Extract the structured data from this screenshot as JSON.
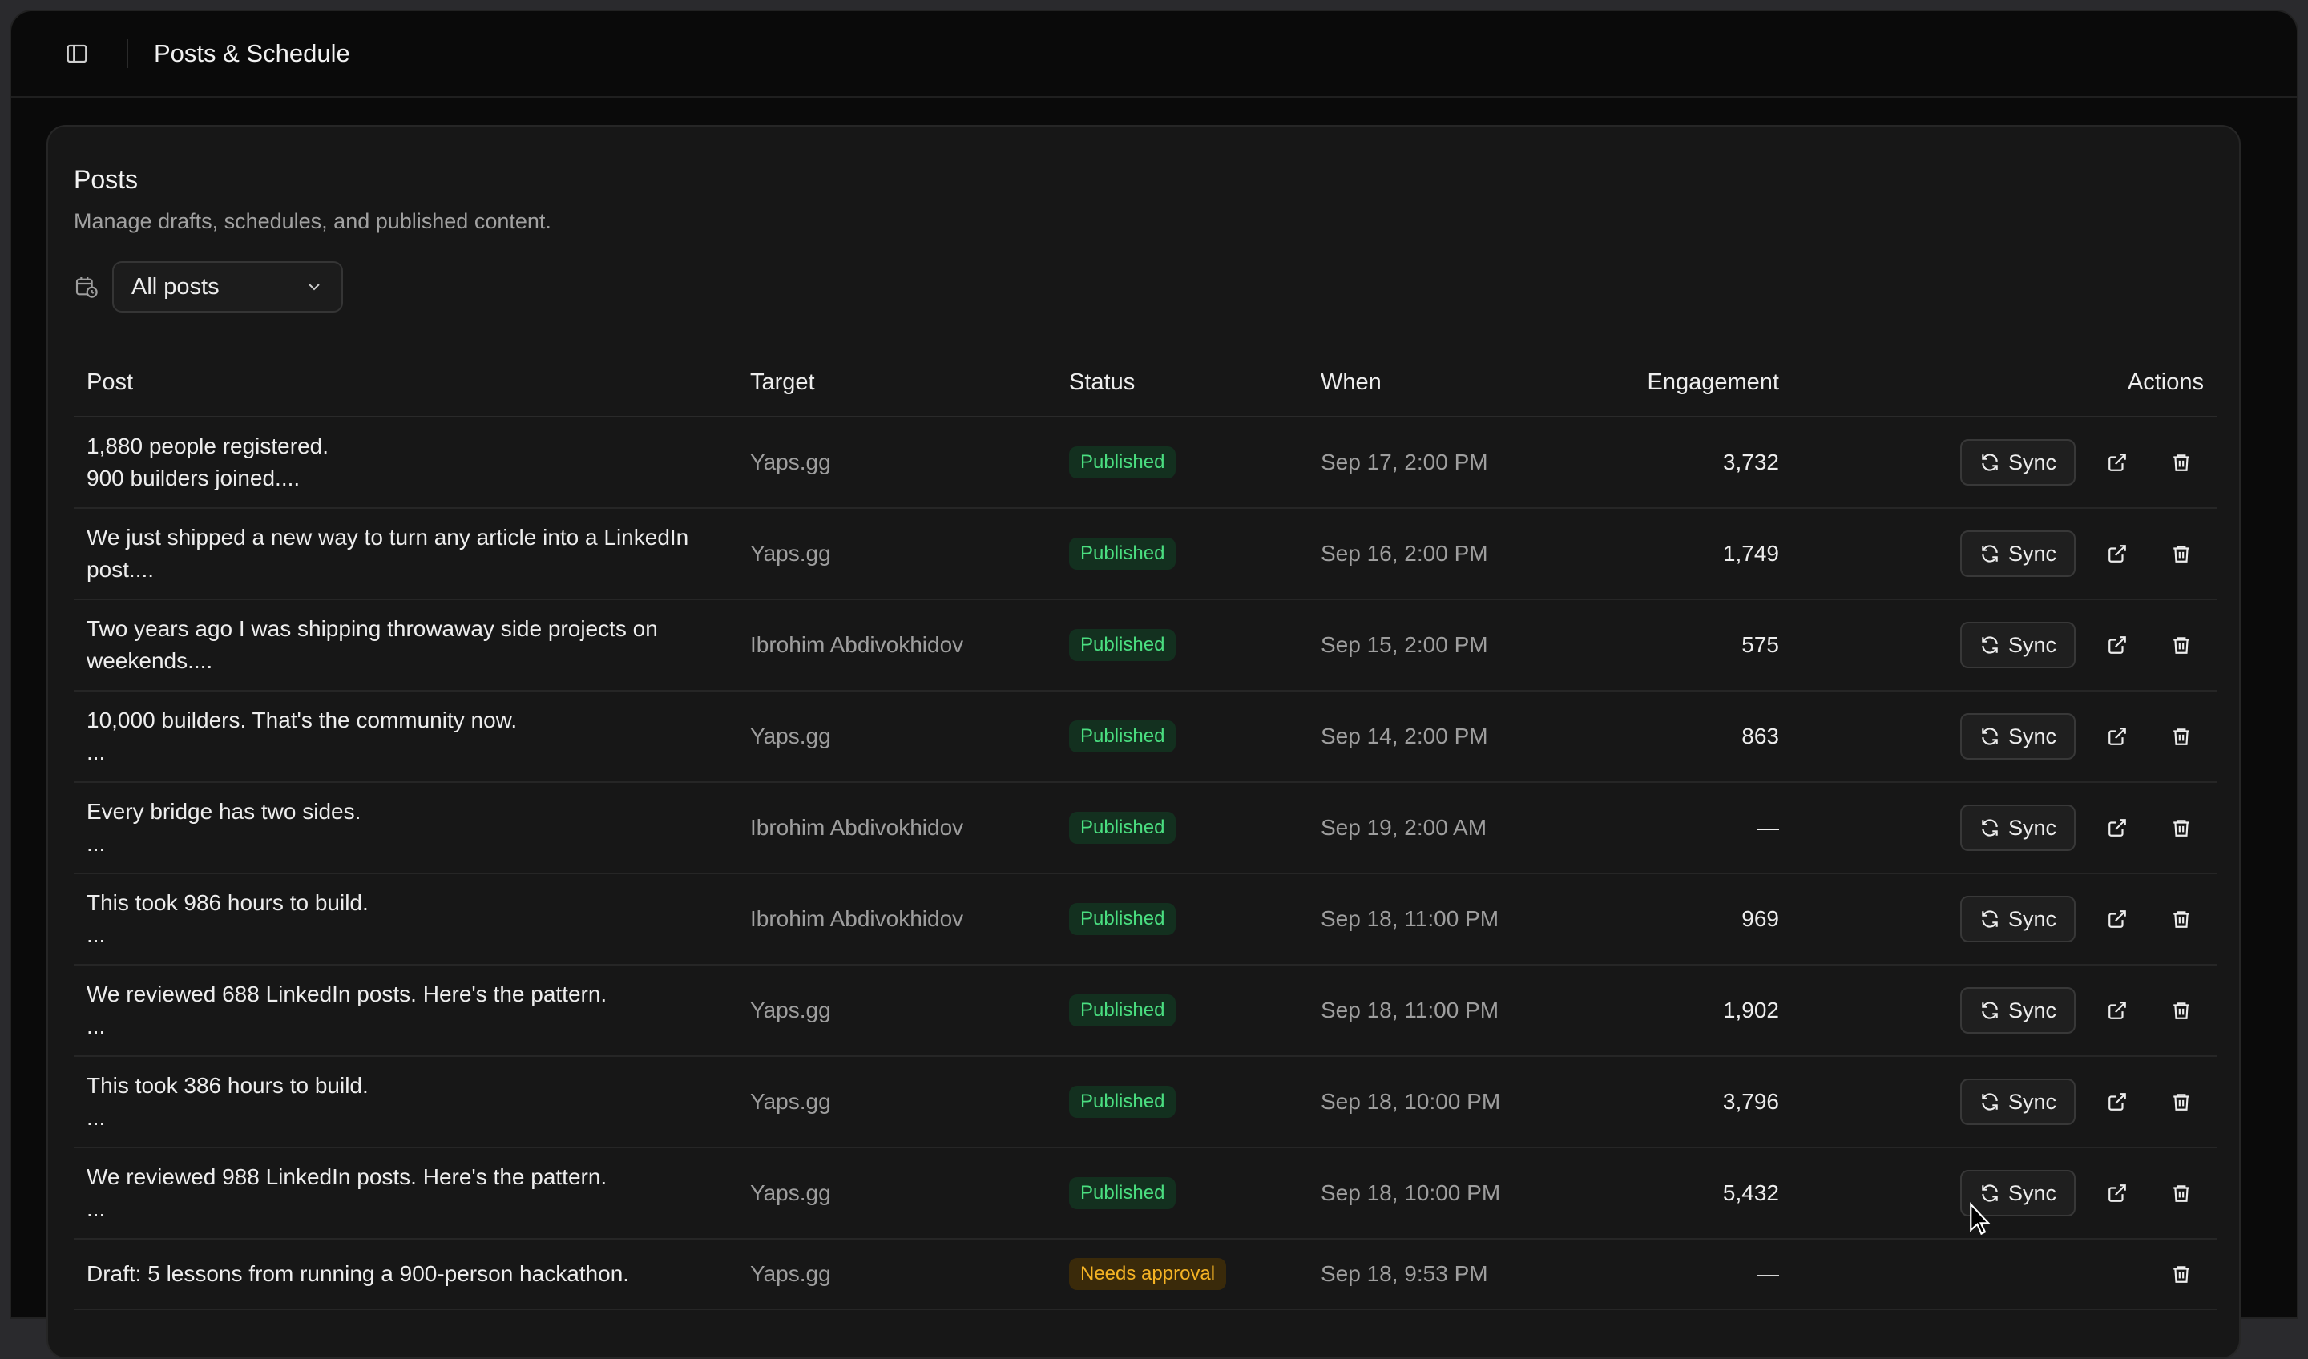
{
  "header": {
    "title": "Posts & Schedule"
  },
  "card": {
    "title": "Posts",
    "subtitle": "Manage drafts, schedules, and published content.",
    "filter": {
      "selected": "All posts"
    }
  },
  "table": {
    "columns": {
      "post": "Post",
      "target": "Target",
      "status": "Status",
      "when": "When",
      "engagement": "Engagement",
      "actions": "Actions"
    },
    "sync_label": "Sync",
    "rows": [
      {
        "post_line1": "1,880 people registered.",
        "post_line2": "900 builders joined....",
        "target": "Yaps.gg",
        "status": "Published",
        "when": "Sep 17, 2:00 PM",
        "engagement": "3,732"
      },
      {
        "post_line1": "We just shipped a new way to turn any article into a LinkedIn",
        "post_line2": "post....",
        "target": "Yaps.gg",
        "status": "Published",
        "when": "Sep 16, 2:00 PM",
        "engagement": "1,749"
      },
      {
        "post_line1": "Two years ago I was shipping throwaway side projects on",
        "post_line2": "weekends....",
        "target": "Ibrohim Abdivokhidov",
        "status": "Published",
        "when": "Sep 15, 2:00 PM",
        "engagement": "575"
      },
      {
        "post_line1": "10,000 builders. That's the community now.",
        "post_line2": "...",
        "target": "Yaps.gg",
        "status": "Published",
        "when": "Sep 14, 2:00 PM",
        "engagement": "863"
      },
      {
        "post_line1": "Every bridge has two sides.",
        "post_line2": "...",
        "target": "Ibrohim Abdivokhidov",
        "status": "Published",
        "when": "Sep 19, 2:00 AM",
        "engagement": "—"
      },
      {
        "post_line1": "This took 986 hours to build.",
        "post_line2": "...",
        "target": "Ibrohim Abdivokhidov",
        "status": "Published",
        "when": "Sep 18, 11:00 PM",
        "engagement": "969"
      },
      {
        "post_line1": "We reviewed 688 LinkedIn posts. Here's the pattern.",
        "post_line2": "...",
        "target": "Yaps.gg",
        "status": "Published",
        "when": "Sep 18, 11:00 PM",
        "engagement": "1,902"
      },
      {
        "post_line1": "This took 386 hours to build.",
        "post_line2": "...",
        "target": "Yaps.gg",
        "status": "Published",
        "when": "Sep 18, 10:00 PM",
        "engagement": "3,796"
      },
      {
        "post_line1": "We reviewed 988 LinkedIn posts. Here's the pattern.",
        "post_line2": "...",
        "target": "Yaps.gg",
        "status": "Published",
        "when": "Sep 18, 10:00 PM",
        "engagement": "5,432"
      }
    ],
    "draft_row": {
      "post": "Draft: 5 lessons from running a 900-person hackathon.",
      "target": "Yaps.gg",
      "status": "Needs approval",
      "when": "Sep 18, 9:53 PM",
      "engagement": "—"
    }
  }
}
